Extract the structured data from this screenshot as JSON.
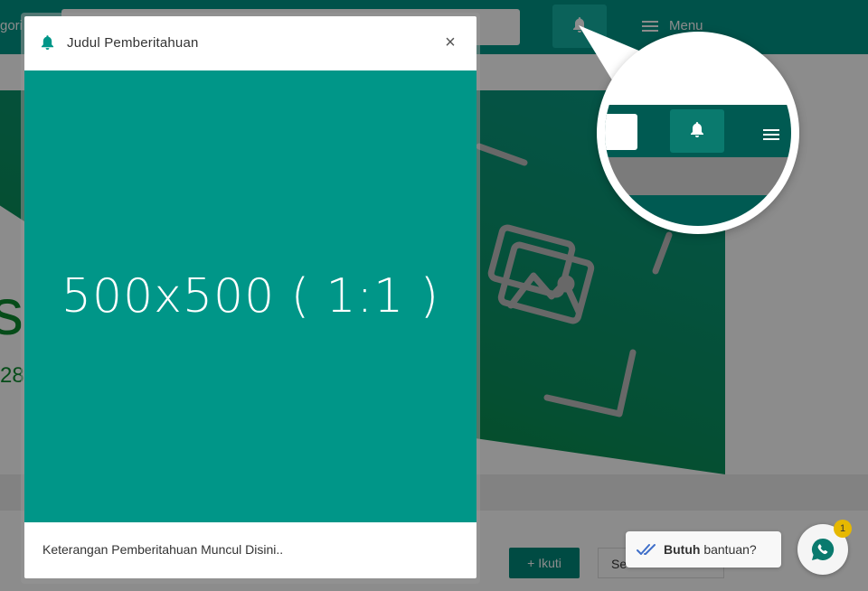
{
  "topbar": {
    "category_fragment": "gori",
    "menu_label": "Menu"
  },
  "background": {
    "big_letter": "s",
    "number_fragment": "28",
    "follow_button": "+  Ikuti",
    "select_fragment": "Se"
  },
  "modal": {
    "title": "Judul Pemberitahuan",
    "close": "×",
    "image_placeholder": "500x500 ( 1:1 )",
    "description": "Keterangan Pemberitahuan Muncul Disini.."
  },
  "chat": {
    "bubble_bold": "Butuh",
    "bubble_text": "bantuan?",
    "badge_count": "1"
  },
  "colors": {
    "teal": "#009688",
    "dark_teal": "#005a52",
    "green": "#0c8a2e",
    "badge": "#e6b800"
  },
  "icons": {
    "bell": "bell-icon",
    "menu": "hamburger-icon",
    "close": "close-icon",
    "whatsapp": "whatsapp-icon",
    "double_check": "double-check-icon",
    "image": "image-icon"
  }
}
